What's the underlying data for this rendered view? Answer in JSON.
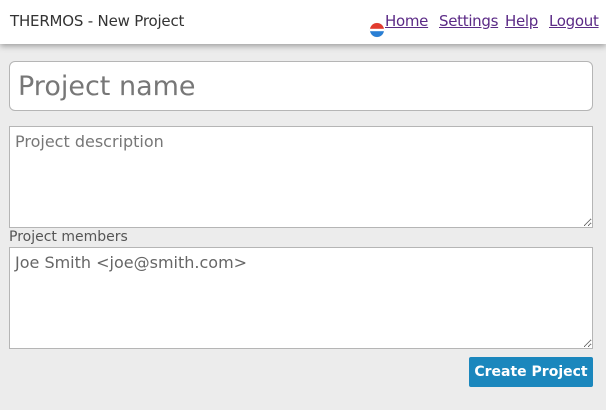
{
  "header": {
    "title": "THERMOS - New Project",
    "logo_icon": "thermos-logo-icon",
    "nav": {
      "home": "Home",
      "settings": "Settings",
      "help": "Help",
      "logout": "Logout"
    },
    "link_color": "#5b2a86"
  },
  "form": {
    "name_placeholder": "Project name",
    "description_placeholder": "Project description",
    "members_label": "Project members",
    "members_value": "Joe Smith <joe@smith.com>",
    "submit_label": "Create Project",
    "submit_color": "#1b87bd"
  }
}
